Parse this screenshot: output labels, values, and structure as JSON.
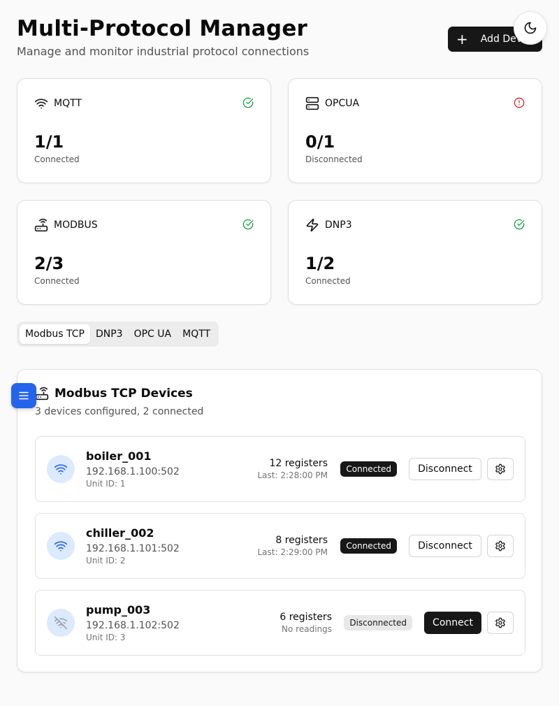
{
  "header": {
    "title": "Multi-Protocol Manager",
    "subtitle": "Manage and monitor industrial protocol connections",
    "add_button_label": "Add Device",
    "theme_toggle_icon": "moon-icon"
  },
  "colors": {
    "ok": "#16a34a",
    "error": "#dc2626",
    "accent": "#2563eb",
    "dark": "#171717"
  },
  "protocol_cards": [
    {
      "name": "MQTT",
      "icon": "wifi-icon",
      "count": "1/1",
      "status_label": "Connected",
      "status": "ok"
    },
    {
      "name": "OPCUA",
      "icon": "server-icon",
      "count": "0/1",
      "status_label": "Disconnected",
      "status": "error"
    },
    {
      "name": "MODBUS",
      "icon": "router-icon",
      "count": "2/3",
      "status_label": "Connected",
      "status": "ok"
    },
    {
      "name": "DNP3",
      "icon": "zap-icon",
      "count": "1/2",
      "status_label": "Connected",
      "status": "ok"
    }
  ],
  "tabs": [
    {
      "label": "Modbus TCP",
      "active": true
    },
    {
      "label": "DNP3",
      "active": false
    },
    {
      "label": "OPC UA",
      "active": false
    },
    {
      "label": "MQTT",
      "active": false
    }
  ],
  "panel": {
    "title": "Modbus TCP Devices",
    "subtitle": "3 devices configured, 2 connected",
    "icon": "router-icon"
  },
  "devices": [
    {
      "name": "boiler_001",
      "address": "192.168.1.100:502",
      "unit": "Unit ID: 1",
      "registers": "12 registers",
      "last": "Last: 2:28:00 PM",
      "status": "Connected",
      "action": "Disconnect",
      "icon": "wifi-icon"
    },
    {
      "name": "chiller_002",
      "address": "192.168.1.101:502",
      "unit": "Unit ID: 2",
      "registers": "8 registers",
      "last": "Last: 2:29:00 PM",
      "status": "Connected",
      "action": "Disconnect",
      "icon": "wifi-icon"
    },
    {
      "name": "pump_003",
      "address": "192.168.1.102:502",
      "unit": "Unit ID: 3",
      "registers": "6 registers",
      "last": "No readings",
      "status": "Disconnected",
      "action": "Connect",
      "icon": "wifi-off-icon"
    }
  ]
}
